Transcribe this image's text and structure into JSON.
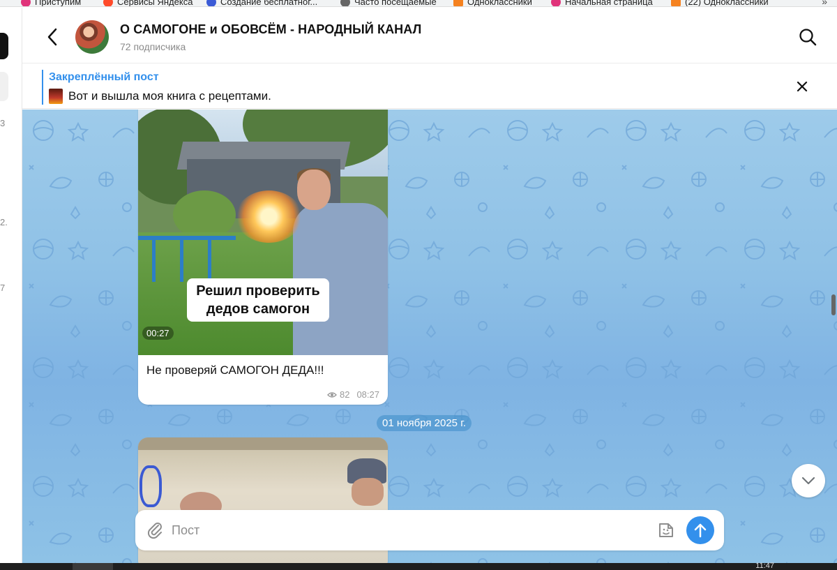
{
  "bookmarks": {
    "items": [
      {
        "label": "Приступим",
        "color": "#e0337a"
      },
      {
        "label": "Сервисы Яндекса",
        "color": "#ff4b2b"
      },
      {
        "label": "Создание бесплатног...",
        "color": "#3b5bd6"
      },
      {
        "label": "Часто посещаемые",
        "color": "#666666"
      },
      {
        "label": "Одноклассники",
        "color": "#f58220"
      },
      {
        "label": "Начальная страница",
        "color": "#e0337a"
      },
      {
        "label": "(22) Одноклассники",
        "color": "#f58220"
      }
    ],
    "more_icon": "chevron-double-right-icon"
  },
  "left_strip": {
    "nums": [
      "3",
      "2.",
      "7"
    ]
  },
  "header": {
    "title": "О САМОГОНЕ и ОБОВСЁМ - НАРОДНЫЙ КАНАЛ",
    "subscribers": "72 подписчика",
    "back_icon": "chevron-left-icon",
    "search_icon": "search-icon"
  },
  "pinned": {
    "label": "Закреплённый пост",
    "text": "Вот и вышла моя книга с рецептами.",
    "close_icon": "close-icon"
  },
  "messages": [
    {
      "video_caption": "Решил проверить дедов самогон",
      "duration": "00:27",
      "text": "Не проверяй САМОГОН ДЕДА!!!",
      "views": "82",
      "time": "08:27"
    }
  ],
  "date_separator": "01 ноября 2025 г.",
  "composer": {
    "placeholder": "Пост",
    "attach_icon": "paperclip-icon",
    "sticker_icon": "sticker-icon",
    "send_icon": "arrow-up-icon"
  },
  "taskbar": {
    "clock": "11:47"
  },
  "colors": {
    "accent": "#3390ec",
    "chat_bg": "#8fc1e6"
  }
}
